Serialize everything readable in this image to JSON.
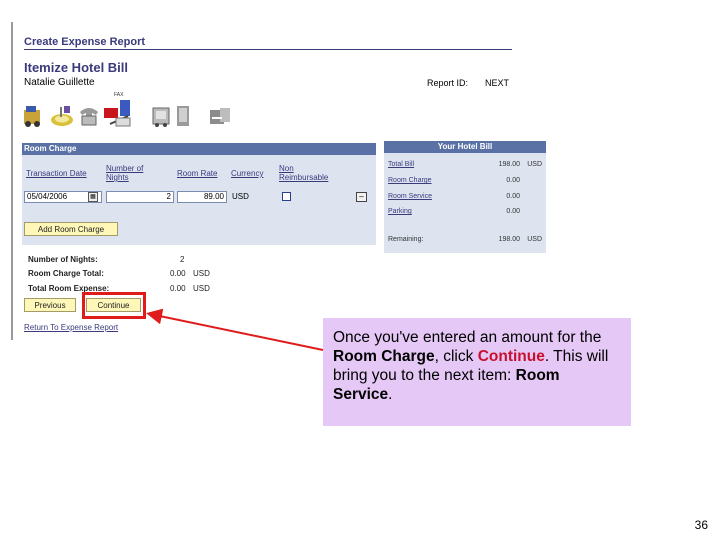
{
  "header": {
    "section_title": "Create Expense Report",
    "page_title": "Itemize Hotel Bill",
    "employee_name": "Natalie Guillette",
    "report_id_label": "Report ID:",
    "report_id_value": "NEXT"
  },
  "toolbar": {
    "icons": [
      "car-icon",
      "dining-icon",
      "telephone-icon",
      "fax-icon",
      "taxi-icon",
      "laundry-icon",
      "parking-icon"
    ],
    "fax_label": "FAX"
  },
  "room_charge": {
    "title": "Room Charge",
    "columns": [
      "Transaction Date",
      "Number of Nights",
      "Room Rate",
      "Currency",
      "Non Reimbursable"
    ],
    "row": {
      "date": "05/04/2006",
      "nights": "2",
      "rate": "89.00",
      "currency": "USD"
    },
    "add_button": "Add Room Charge"
  },
  "summary": {
    "nights_label": "Number of Nights:",
    "nights_value": "2",
    "total_label": "Room Charge Total:",
    "total_value": "0.00",
    "total_currency": "USD",
    "expense_label": "Total Room Expense:",
    "expense_value": "0.00",
    "expense_currency": "USD"
  },
  "nav": {
    "previous": "Previous",
    "continue": "Continue",
    "return_link": "Return To Expense Report"
  },
  "hotel_bill": {
    "title": "Your Hotel Bill",
    "rows": [
      {
        "label": "Total Bill",
        "value": "198.00",
        "currency": "USD"
      },
      {
        "label": "Room Charge",
        "value": "0.00",
        "currency": ""
      },
      {
        "label": "Room Service",
        "value": "0.00",
        "currency": ""
      },
      {
        "label": "Parking",
        "value": "0.00",
        "currency": ""
      }
    ],
    "remaining_label": "Remaining:",
    "remaining_value": "198.00",
    "remaining_currency": "USD"
  },
  "callout": {
    "part1": "Once you've entered an amount for the ",
    "room_charge": "Room Charge",
    "part2": ", click ",
    "continue": "Continue",
    "part3": ". This will bring you to the next item: ",
    "room_service": "Room Service",
    "part4": "."
  },
  "page_number": "36",
  "colors": {
    "header_blue": "#5a71a6",
    "panel_bg": "#dde4f0",
    "button_yellow": "#fff7b8",
    "highlight_red": "#e01b1b",
    "callout_bg": "#e5c8f5"
  }
}
